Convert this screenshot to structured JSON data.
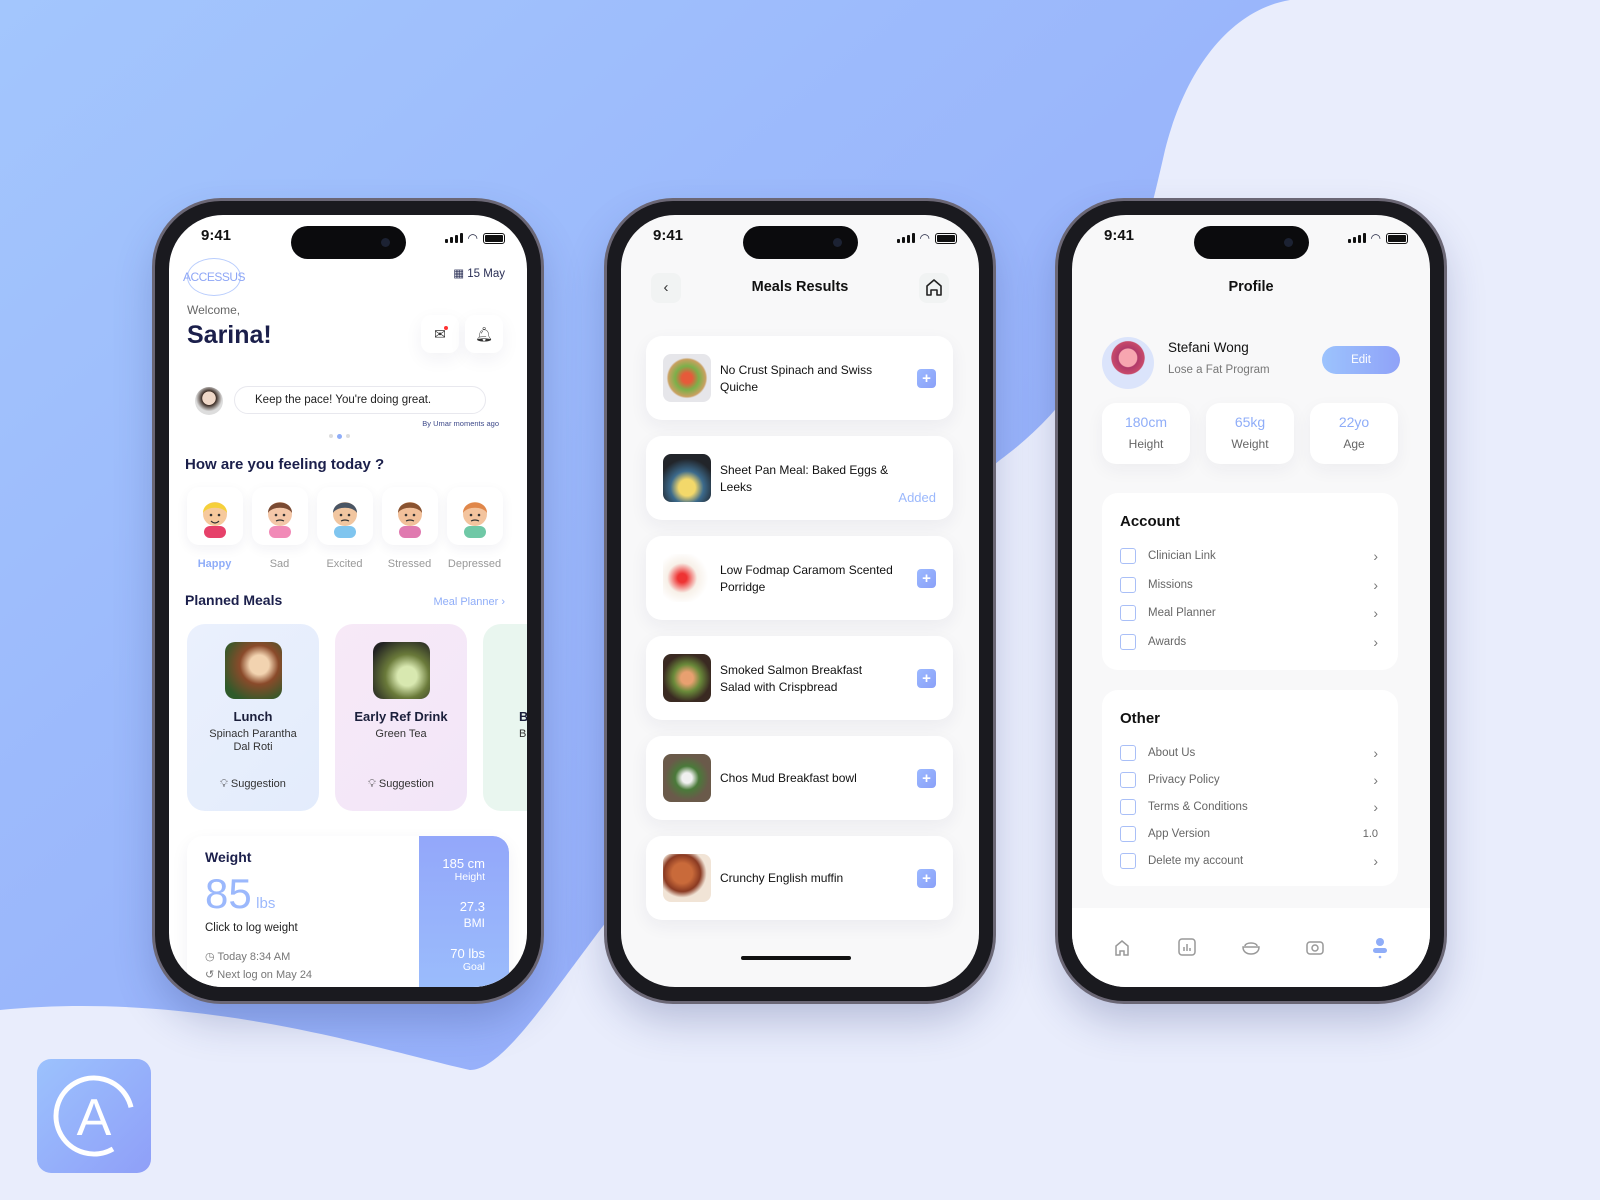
{
  "colors": {
    "accent": "#8fadf8",
    "background": "#e9edfc",
    "blob": "#9bb6fb"
  },
  "status": {
    "time": "9:41"
  },
  "home": {
    "logo": "ACCESSUS",
    "date": "15 May",
    "welcome": "Welcome,",
    "name": "Sarina!",
    "message": "Keep the pace! You're doing great.",
    "message_meta": "By Umar moments ago",
    "feeling_title": "How are you feeling today ?",
    "moods": [
      {
        "label": "Happy",
        "selected": true
      },
      {
        "label": "Sad"
      },
      {
        "label": "Excited"
      },
      {
        "label": "Stressed"
      },
      {
        "label": "Depressed"
      }
    ],
    "planned_title": "Planned Meals",
    "planner_link": "Meal Planner",
    "meals": [
      {
        "title": "Lunch",
        "sub": "Spinach Parantha Dal Roti",
        "tag": "Suggestion"
      },
      {
        "title": "Early Ref Drink",
        "sub": "Green Tea",
        "tag": "Suggestion"
      },
      {
        "title": "B",
        "sub": "Br",
        "tag": ""
      }
    ],
    "weight": {
      "title": "Weight",
      "value": "85",
      "unit": "lbs",
      "cta": "Click to log weight",
      "last": "Today 8:34 AM",
      "next": "Next log on May 24",
      "height_v": "185 cm",
      "height_l": "Height",
      "bmi_v": "27.3",
      "bmi_l": "BMI",
      "goal_v": "70 lbs",
      "goal_l": "Goal"
    }
  },
  "results": {
    "title": "Meals Results",
    "items": [
      {
        "name": "No Crust Spinach and Swiss Quiche",
        "added": false
      },
      {
        "name": "Sheet Pan Meal: Baked Eggs & Leeks",
        "added": true,
        "status": "Added"
      },
      {
        "name": "Low Fodmap Caramom Scented Porridge",
        "added": false
      },
      {
        "name": "Smoked Salmon Breakfast Salad with Crispbread",
        "added": false
      },
      {
        "name": "Chos Mud Breakfast bowl",
        "added": false
      },
      {
        "name": "Crunchy English muffin",
        "added": false
      }
    ]
  },
  "profile": {
    "title": "Profile",
    "name": "Stefani Wong",
    "program": "Lose a Fat Program",
    "edit": "Edit",
    "stats": [
      {
        "v": "180cm",
        "l": "Height"
      },
      {
        "v": "65kg",
        "l": "Weight"
      },
      {
        "v": "22yo",
        "l": "Age"
      }
    ],
    "account_title": "Account",
    "account": [
      {
        "label": "Clinician Link"
      },
      {
        "label": "Missions"
      },
      {
        "label": "Meal Planner"
      },
      {
        "label": "Awards"
      }
    ],
    "other_title": "Other",
    "other": [
      {
        "label": "About Us",
        "value": ""
      },
      {
        "label": "Privacy Policy",
        "value": ""
      },
      {
        "label": "Terms & Conditions",
        "value": ""
      },
      {
        "label": "App Version",
        "value": "1.0"
      },
      {
        "label": "Delete my account",
        "value": ""
      }
    ],
    "nav": [
      "home-icon",
      "chart-icon",
      "bowl-icon",
      "camera-icon",
      "profile-icon"
    ],
    "nav_active": 4
  }
}
